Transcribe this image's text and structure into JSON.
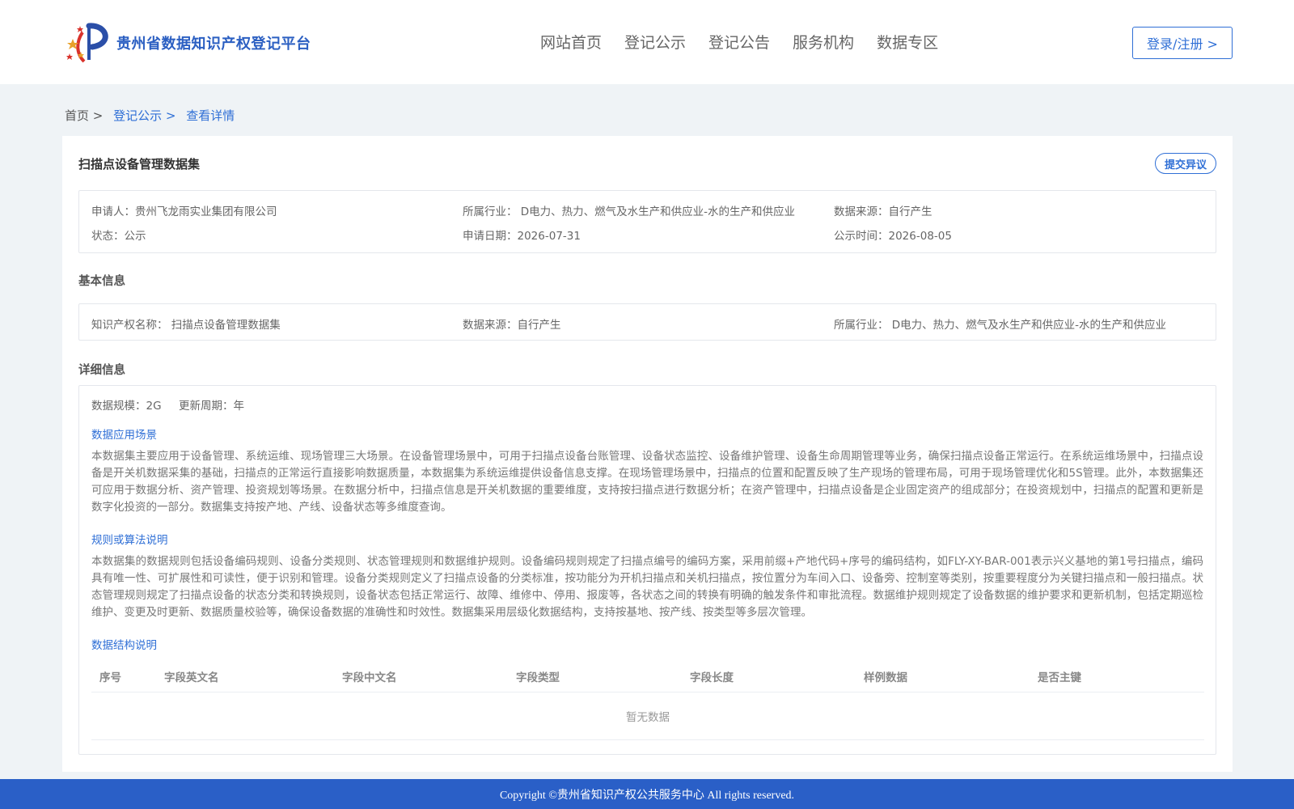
{
  "header": {
    "site_title": "贵州省数据知识产权登记平台",
    "nav": [
      "网站首页",
      "登记公示",
      "登记公告",
      "服务机构",
      "数据专区"
    ],
    "login_label": "登录/注册 >",
    "brand_color": "#2b5fc2"
  },
  "breadcrumb": {
    "home": "首页 >",
    "level2": "登记公示 >",
    "current": "查看详情"
  },
  "record": {
    "title": "扫描点设备管理数据集",
    "objection_label": "提交异议",
    "summary": {
      "applicant": "申请人：贵州飞龙雨实业集团有限公司",
      "industry": "所属行业： D电力、热力、燃气及水生产和供应业-水的生产和供应业",
      "source": "数据来源：自行产生",
      "status": "状态：公示",
      "apply_date": "申请日期：2026-07-31",
      "publish_date": "公示时间：2026-08-05"
    },
    "basic_title": "基本信息",
    "basic": {
      "ip_name": "知识产权名称： 扫描点设备管理数据集",
      "source": "数据来源：自行产生",
      "industry": "所属行业： D电力、热力、燃气及水生产和供应业-水的生产和供应业"
    },
    "detail_title": "详细信息",
    "detail": {
      "scale": "数据规模：2G",
      "cycle": "更新周期：年",
      "scenario_title": "数据应用场景",
      "scenario_text": "本数据集主要应用于设备管理、系统运维、现场管理三大场景。在设备管理场景中，可用于扫描点设备台账管理、设备状态监控、设备维护管理、设备生命周期管理等业务，确保扫描点设备正常运行。在系统运维场景中，扫描点设备是开关机数据采集的基础，扫描点的正常运行直接影响数据质量，本数据集为系统运维提供设备信息支撑。在现场管理场景中，扫描点的位置和配置反映了生产现场的管理布局，可用于现场管理优化和5S管理。此外，本数据集还可应用于数据分析、资产管理、投资规划等场景。在数据分析中，扫描点信息是开关机数据的重要维度，支持按扫描点进行数据分析；在资产管理中，扫描点设备是企业固定资产的组成部分；在投资规划中，扫描点的配置和更新是数字化投资的一部分。数据集支持按产地、产线、设备状态等多维度查询。",
      "rules_title": "规则或算法说明",
      "rules_text": "本数据集的数据规则包括设备编码规则、设备分类规则、状态管理规则和数据维护规则。设备编码规则规定了扫描点编号的编码方案，采用前缀+产地代码+序号的编码结构，如FLY-XY-BAR-001表示兴义基地的第1号扫描点，编码具有唯一性、可扩展性和可读性，便于识别和管理。设备分类规则定义了扫描点设备的分类标准，按功能分为开机扫描点和关机扫描点，按位置分为车间入口、设备旁、控制室等类别，按重要程度分为关键扫描点和一般扫描点。状态管理规则规定了扫描点设备的状态分类和转换规则，设备状态包括正常运行、故障、维修中、停用、报废等，各状态之间的转换有明确的触发条件和审批流程。数据维护规则规定了设备数据的维护要求和更新机制，包括定期巡检维护、变更及时更新、数据质量校验等，确保设备数据的准确性和时效性。数据集采用层级化数据结构，支持按基地、按产线、按类型等多层次管理。",
      "structure_title": "数据结构说明",
      "table_headers": [
        "序号",
        "字段英文名",
        "字段中文名",
        "字段类型",
        "字段长度",
        "样例数据",
        "是否主键"
      ],
      "table_empty": "暂无数据"
    }
  },
  "footer": {
    "copyright": "Copyright ©贵州省知识产权公共服务中心 All rights reserved."
  }
}
